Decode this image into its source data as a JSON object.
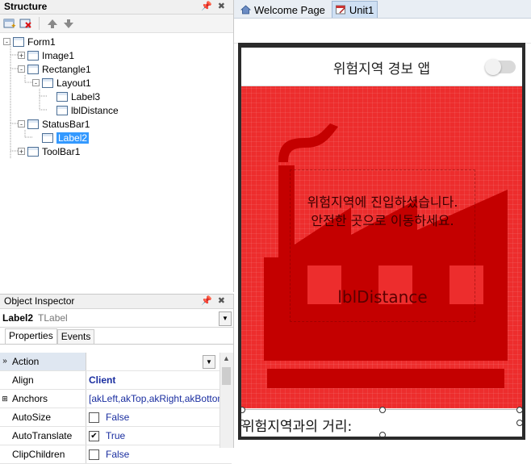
{
  "structure": {
    "title": "Structure",
    "tree": [
      {
        "label": "Form1",
        "expander": "-"
      },
      {
        "label": "Image1",
        "expander": "+"
      },
      {
        "label": "Rectangle1",
        "expander": "-"
      },
      {
        "label": "Layout1",
        "expander": "-"
      },
      {
        "label": "Label3",
        "expander": ""
      },
      {
        "label": "lblDistance",
        "expander": ""
      },
      {
        "label": "StatusBar1",
        "expander": "-"
      },
      {
        "label": "Label2",
        "expander": "",
        "selected": true
      },
      {
        "label": "ToolBar1",
        "expander": "+"
      }
    ]
  },
  "inspector": {
    "title": "Object Inspector",
    "object_name": "Label2",
    "object_type": "TLabel",
    "tabs": [
      "Properties",
      "Events"
    ],
    "rows": [
      {
        "name": "Action",
        "value": ""
      },
      {
        "name": "Align",
        "value": "Client"
      },
      {
        "name": "Anchors",
        "value": "[akLeft,akTop,akRight,akBottom]"
      },
      {
        "name": "AutoSize",
        "value": "False",
        "checked": false
      },
      {
        "name": "AutoTranslate",
        "value": "True",
        "checked": true
      },
      {
        "name": "ClipChildren",
        "value": "False",
        "checked": false
      }
    ]
  },
  "designer": {
    "tabs": [
      {
        "label": "Welcome Page",
        "icon": "house-icon"
      },
      {
        "label": "Unit1",
        "icon": "form-edit-icon",
        "active": true
      }
    ],
    "form": {
      "title": "위험지역 경보 앱",
      "message_line1": "위험지역에 진입하셨습니다.",
      "message_line2": "안전한 곳으로 이동하세요.",
      "distance_label": "lblDistance",
      "status_label": "위험지역과의 거리:",
      "toggle_on": false
    }
  },
  "colors": {
    "accent_selection": "#3399ff",
    "danger_red": "#ed2d2d",
    "factory_dark_red": "#c40000"
  }
}
